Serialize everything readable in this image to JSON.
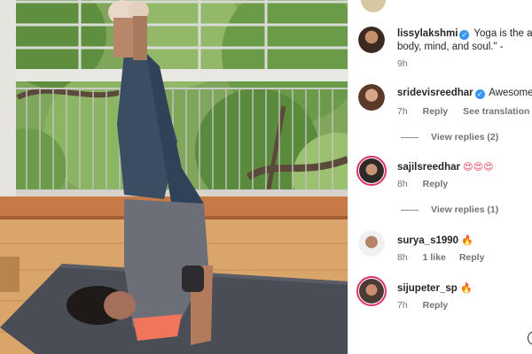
{
  "comments": [
    {
      "username": "lissylakshmi",
      "verified": true,
      "text_line1": "Yoga is the art",
      "text_line2": "body, mind, and soul.\" -",
      "time": "9h"
    },
    {
      "username": "sridevisreedhar",
      "verified": true,
      "text": "Awesome",
      "time": "7h",
      "reply_label": "Reply",
      "translate_label": "See translation",
      "view_replies": "View replies (2)"
    },
    {
      "username": "sajilsreedhar",
      "emojis": "😍😍😍",
      "time": "8h",
      "reply_label": "Reply",
      "view_replies": "View replies (1)"
    },
    {
      "username": "surya_s1990",
      "emoji": "🔥",
      "time": "8h",
      "likes": "1 like",
      "reply_label": "Reply"
    },
    {
      "username": "sijupeter_sp",
      "emoji": "🔥",
      "time": "7h",
      "reply_label": "Reply"
    }
  ],
  "colors": {
    "verified_badge": "#3897f0",
    "story_ring": "#e1306c",
    "meta_text": "#737373"
  },
  "icons": [
    "verified-badge-icon",
    "heart-eyes-emoji",
    "fire-emoji",
    "scroll-circle-icon"
  ]
}
